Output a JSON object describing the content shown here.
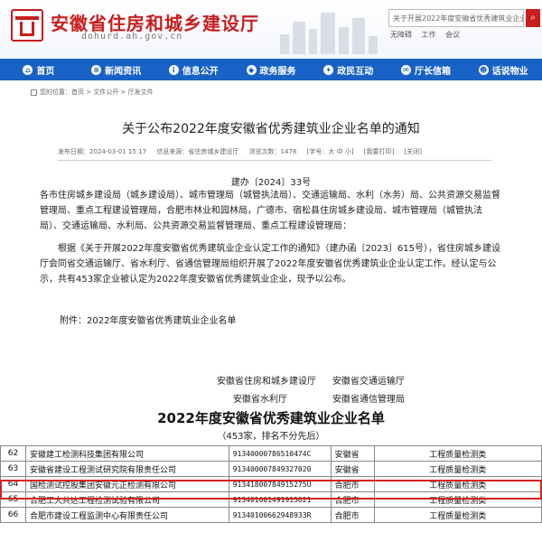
{
  "header": {
    "site_title": "安徽省住房和城乡建设厅",
    "site_url": "dohurd.ah.gov.cn",
    "search_value": "关于开展2022年度安徽省优秀建筑业企业认",
    "search_icon": "search-icon",
    "top_links": [
      "无障碍",
      "工作",
      "会议"
    ]
  },
  "nav": [
    {
      "label": "首页",
      "icon": "home-icon"
    },
    {
      "label": "新闻资讯",
      "icon": "news-icon"
    },
    {
      "label": "信息公开",
      "icon": "info-icon"
    },
    {
      "label": "政务服务",
      "icon": "service-icon"
    },
    {
      "label": "政民互动",
      "icon": "interaction-icon"
    },
    {
      "label": "厅长信箱",
      "icon": "mailbox-icon"
    },
    {
      "label": "话说物业",
      "icon": "property-icon"
    }
  ],
  "breadcrumb": "您的位置：首页 > 文件公开 > 厅发文件",
  "article": {
    "title": "关于公布2022年度安徽省优秀建筑业企业名单的通知",
    "meta": [
      "发布日期：2024-03-01 15:17",
      "信息来源：省住房城乡建设厅",
      "浏览次数：1478",
      "[字号：大 中 小]",
      "[我要打印]",
      "[关闭]"
    ],
    "doc_number": "建办〔2024〕33号",
    "recipients": "各市住房城乡建设局（城乡建设局）、城市管理局（城管执法局）、交通运输局、水利（水务）局、公共资源交易监督管理局、重点工程建设管理局，合肥市林业和园林局，广德市、宿松县住房城乡建设局、城市管理局（城管执法局）、交通运输局、水利局、公共资源交易监督管理局、重点工程建设管理局：",
    "body": "根据《关于开展2022年度安徽省优秀建筑业企业认定工作的通知》（建办函〔2023〕615号），省住房城乡建设厅会同省交通运输厅、省水利厅、省通信管理局组织开展了2022年度安徽省优秀建筑业企业认定工作。经认定与公示，共有453家企业被认定为2022年度安徽省优秀建筑业企业，现予以公布。",
    "attachment": "附件：2022年度安徽省优秀建筑业企业名单",
    "signatories": [
      "安徽省住房和城乡建设厅",
      "安徽省交通运输厅",
      "安徽省水利厅",
      "安徽省通信管理局"
    ]
  },
  "sheet": {
    "title": "2022年度安徽省优秀建筑业企业名单",
    "subtitle": "（453家，排名不分先后）",
    "rows": [
      {
        "no": "62",
        "name": "安徽建工检测科技集团有限公司",
        "code": "91340000786510474C",
        "area": "安徽省",
        "type": "工程质量检测类"
      },
      {
        "no": "63",
        "name": "安徽省建设工程测试研究院有限责任公司",
        "code": "913400007849327020",
        "area": "安徽省",
        "type": "工程质量检测类"
      },
      {
        "no": "64",
        "name": "国检测试控股集团安徽元正检测有限公司",
        "code": "91341800784915275U",
        "area": "合肥市",
        "type": "工程质量检测类"
      },
      {
        "no": "65",
        "name": "合肥工大共达工程检测试验有限公司",
        "code": "913401001491915621",
        "area": "合肥市",
        "type": "工程质量检测类"
      },
      {
        "no": "66",
        "name": "合肥市建设工程监测中心有限责任公司",
        "code": "91340100662948933R",
        "area": "合肥市",
        "type": "工程质量检测类"
      }
    ]
  },
  "colors": {
    "brand_red": "#c81d1d",
    "nav_blue": "#1862c5",
    "highlight": "#d61f1f"
  }
}
